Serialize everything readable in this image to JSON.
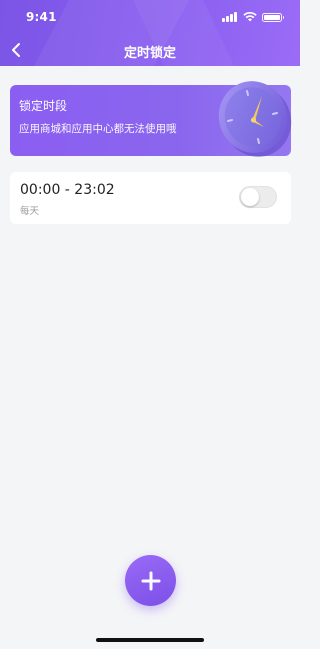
{
  "status_bar": {
    "time": "9:41"
  },
  "nav": {
    "title": "定时锁定"
  },
  "banner": {
    "title": "锁定时段",
    "description": "应用商城和应用中心都无法使用哦"
  },
  "schedules": [
    {
      "time_range": "00:00 - 23:02",
      "repeat": "每天",
      "enabled": false
    }
  ],
  "colors": {
    "accent": "#8a5ef0",
    "background": "#f4f5f7"
  },
  "icons": {
    "back": "chevron-left-icon",
    "add": "plus-icon",
    "clock": "clock-illustration"
  }
}
